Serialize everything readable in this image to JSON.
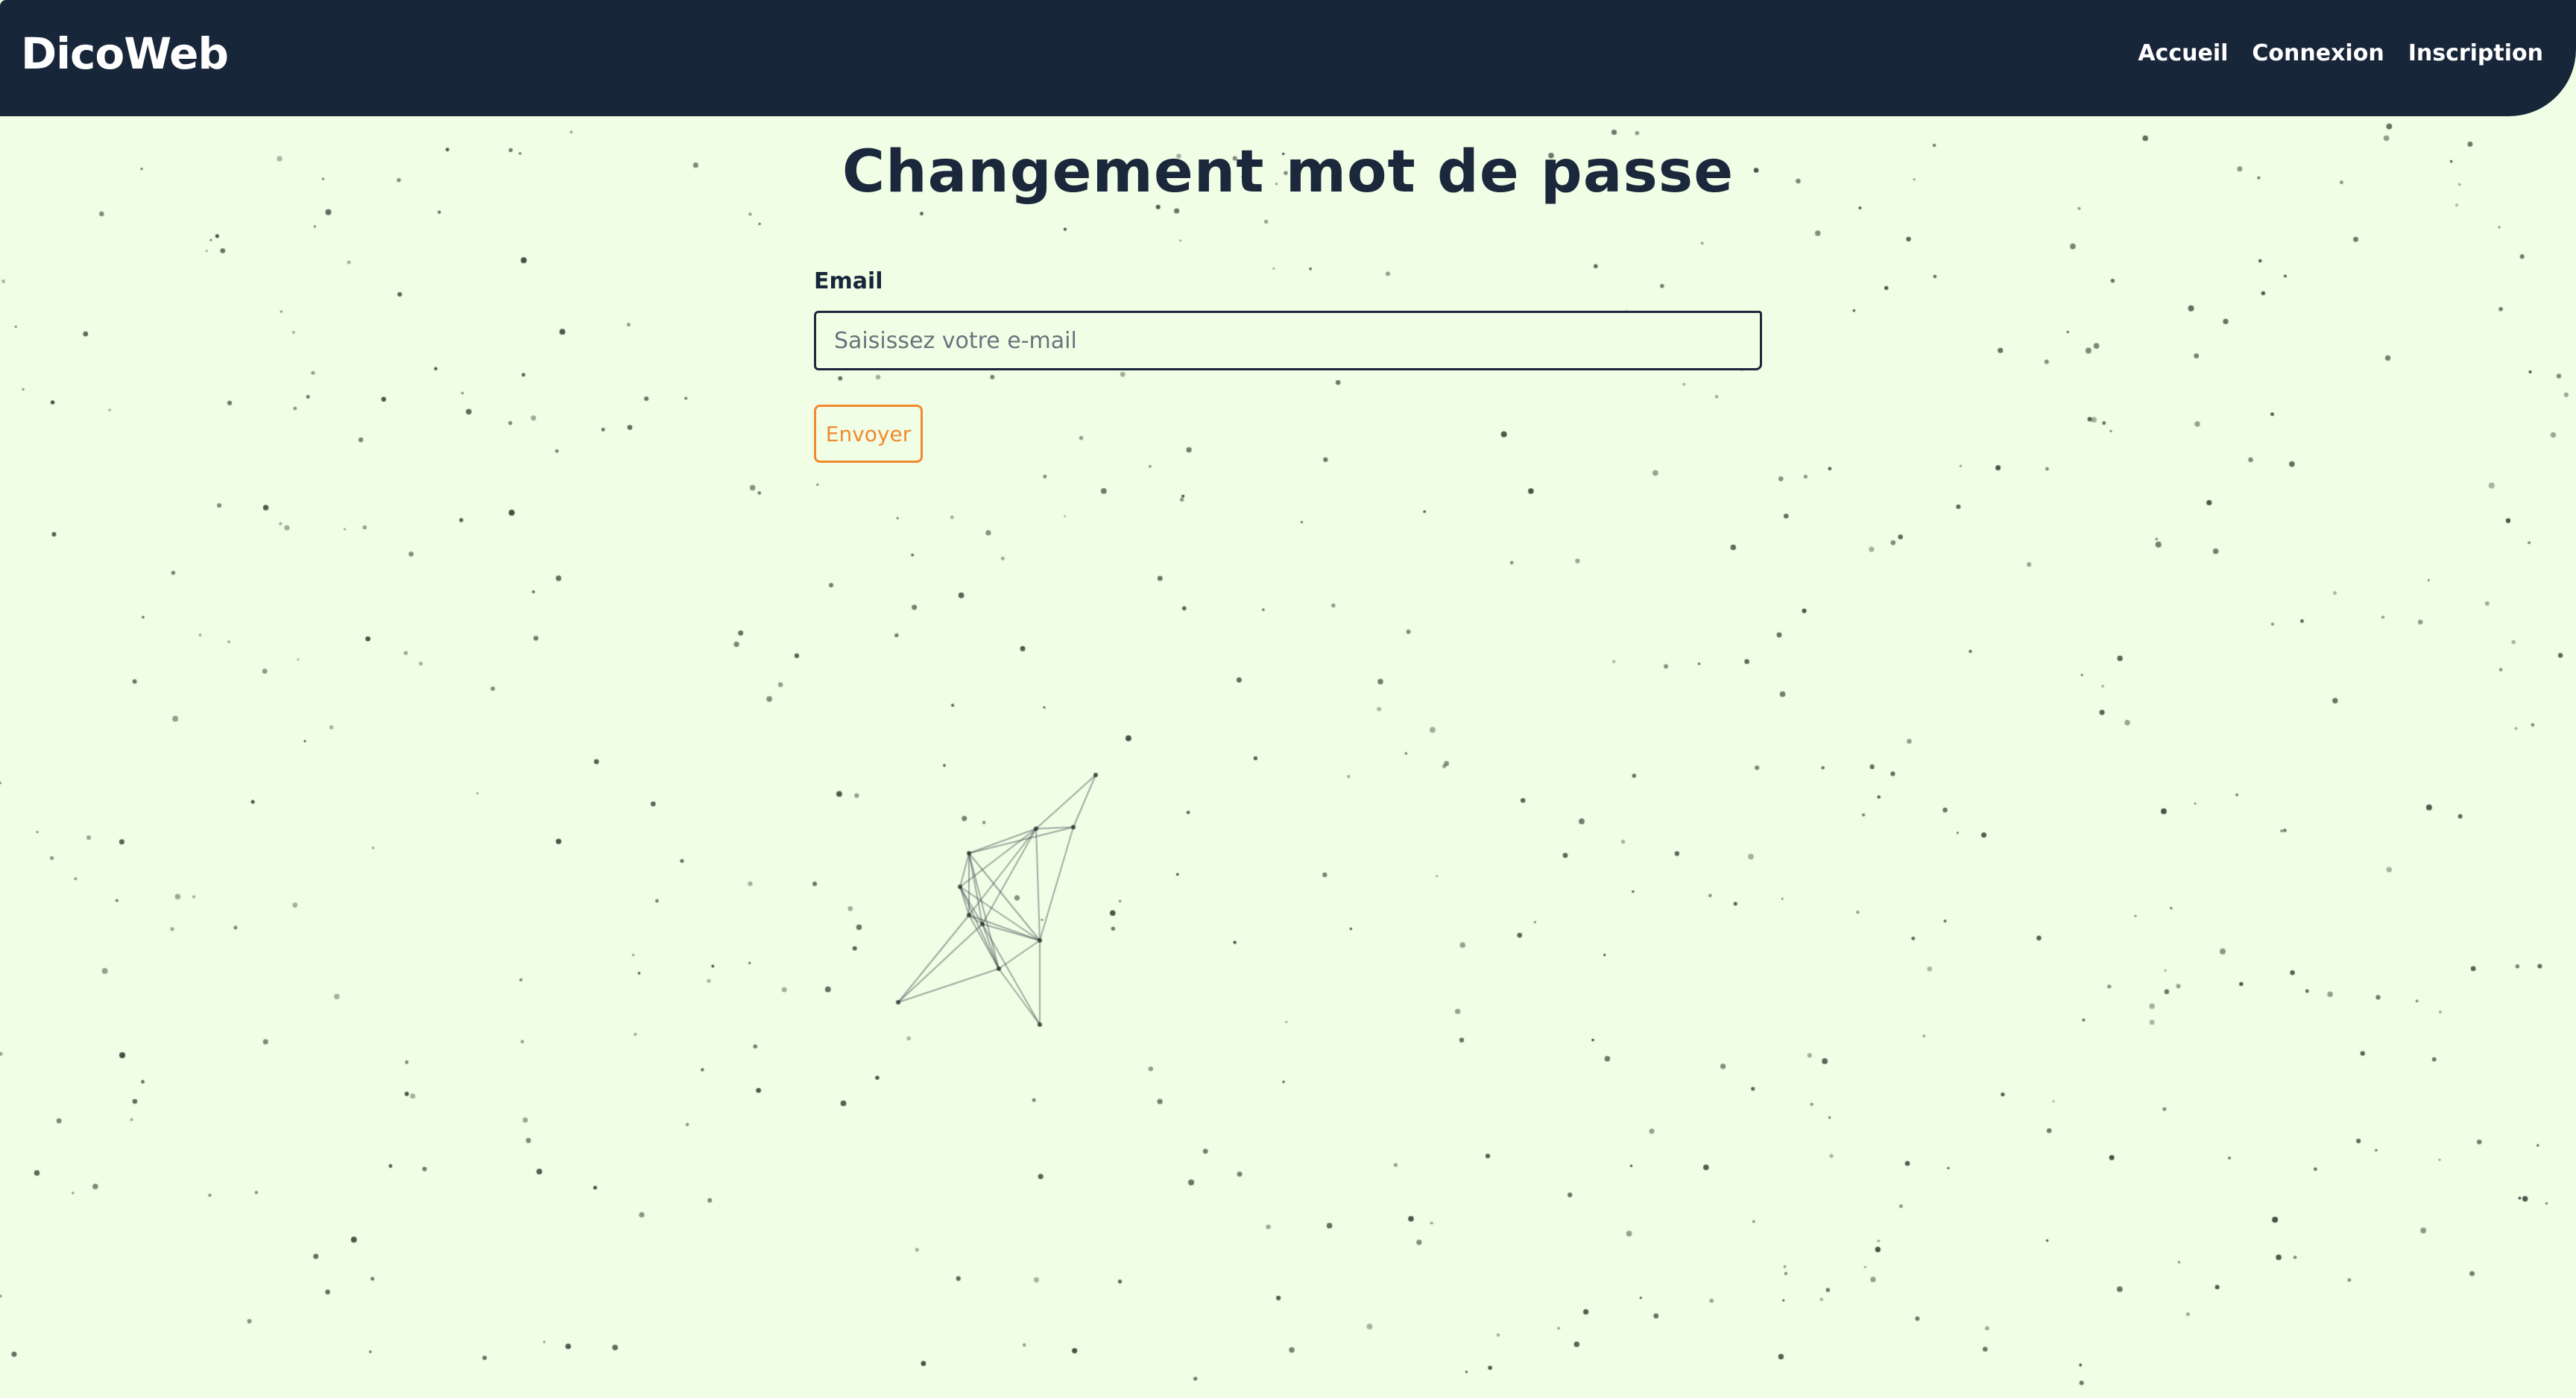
{
  "navbar": {
    "brand": "DicoWeb",
    "links": [
      "Accueil",
      "Connexion",
      "Inscription"
    ]
  },
  "page": {
    "title": "Changement mot de passe"
  },
  "form": {
    "email_label": "Email",
    "email_placeholder": "Saisissez votre e-mail",
    "email_value": "",
    "submit_label": "Envoyer"
  },
  "colors": {
    "background": "#f1fee6",
    "navbar": "#18263a",
    "title": "#1b283b",
    "accent": "#f2892f"
  }
}
